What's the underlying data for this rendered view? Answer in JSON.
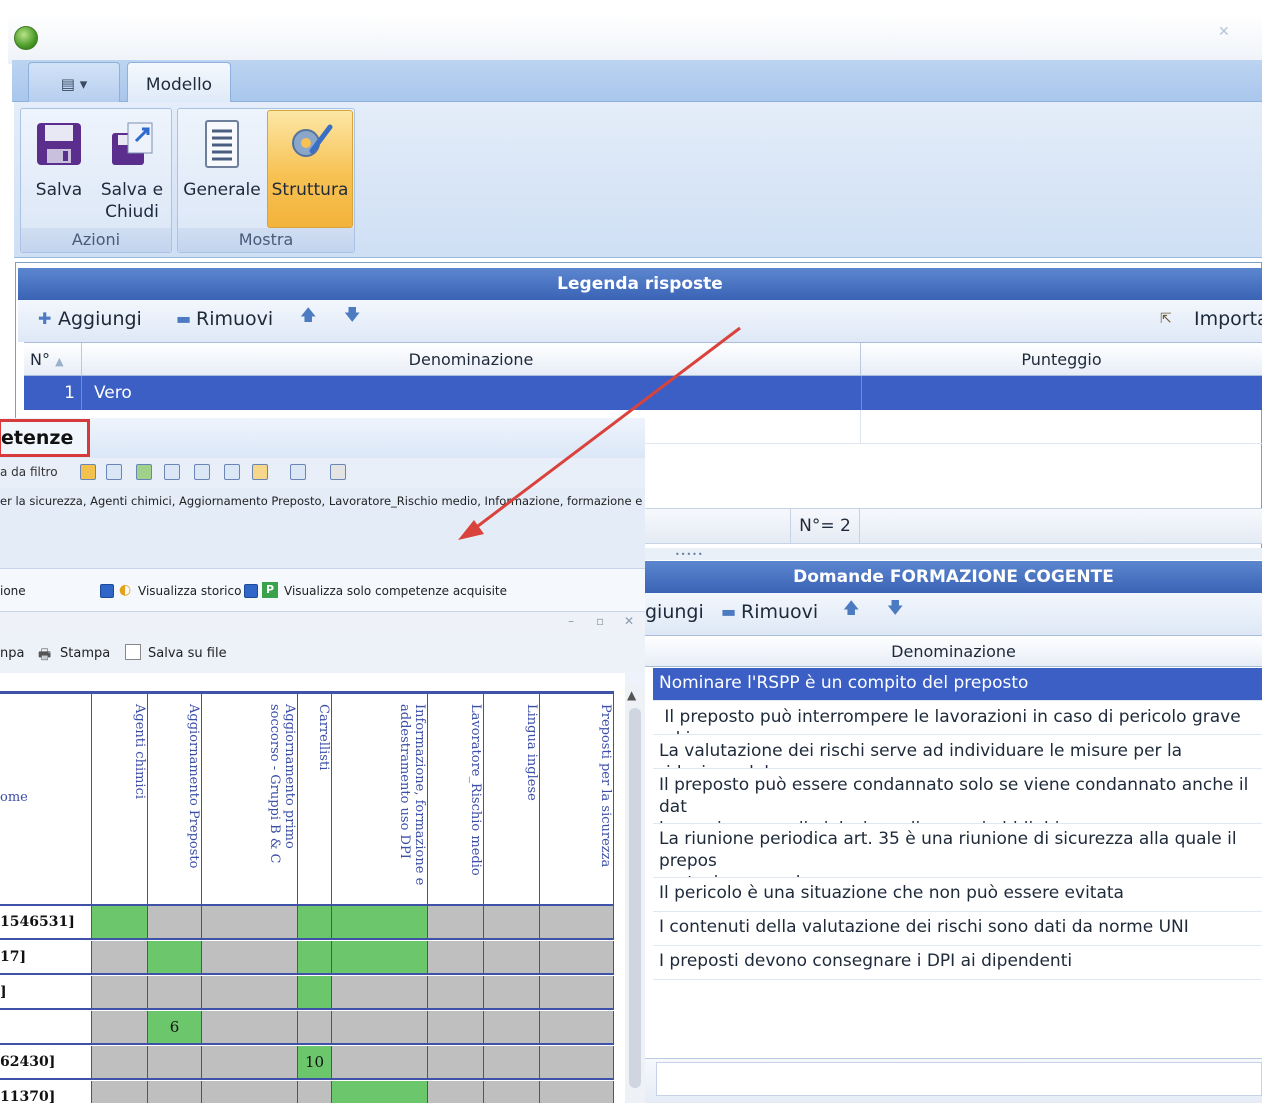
{
  "ribbon": {
    "tab_modello": "Modello",
    "buttons": {
      "salva": "Salva",
      "salva_chiudi_1": "Salva e",
      "salva_chiudi_2": "Chiudi",
      "generale": "Generale",
      "struttura": "Struttura"
    },
    "groups": {
      "azioni": "Azioni",
      "mostra": "Mostra"
    }
  },
  "legenda": {
    "title": "Legenda risposte",
    "toolbar": {
      "aggiungi": "Aggiungi",
      "rimuovi": "Rimuovi",
      "importa": "Importa"
    },
    "columns": {
      "num": "N°",
      "denominazione": "Denominazione",
      "punteggio": "Punteggio"
    },
    "rows": [
      {
        "num": "1",
        "denominazione": "Vero"
      }
    ],
    "count": "N°= 2"
  },
  "domande": {
    "title": "Domande  FORMAZIONE COGENTE",
    "toolbar": {
      "aggiungi": "giungi",
      "rimuovi": "Rimuovi"
    },
    "column": "Denominazione",
    "rows": [
      "Nominare l'RSPP è un compito del preposto",
      " Il preposto può interrompere le lavorazioni in caso di pericolo grave ed im",
      "La valutazione dei rischi serve ad individuare le misure per la riduzione del",
      "Il preposto può essere condannato solo se viene condannato anche il dat\nlavoro in casoo di violazione die propri obblighi",
      "La riunione periodica art. 35 è una riunione di sicurezza alla quale il prepos\npartecipare per legge",
      "Il pericolo è una situazione che non può essere evitata",
      "I contenuti della valutazione dei rischi sono dati da norme UNI",
      "I preposti devono consegnare i DPI ai dipendenti"
    ]
  },
  "competenze": {
    "title": "etenze",
    "toolbar_filter": "a da filtro",
    "filter_text": "er la sicurezza, Agenti chimici, Aggiornamento Preposto, Lavoratore_Rischio medio, Informazione, formazione e addestr",
    "option_left": "ione",
    "option_storico": "Visualizza storico",
    "option_acquisite": "Visualizza solo competenze acquisite",
    "print_left": "npa",
    "print_stampa": "Stampa",
    "print_salva": "Salva su file",
    "row_header_label": "ome",
    "columns": [
      "Agenti chimici",
      "Aggiornamento Preposto",
      "Aggiornamento primo soccorso - Gruppi B & C",
      "Carrellisti",
      "Informazione, formazione e addestramento uso DPI",
      "Lavoratore_Rischio medio",
      "Lingua inglese",
      "Preposti per la sicurezza"
    ],
    "rows": [
      {
        "label": "1546531]",
        "cells": [
          "g",
          "",
          "",
          "g",
          "g",
          "",
          "",
          ""
        ]
      },
      {
        "label": "17]",
        "cells": [
          "",
          "g",
          "",
          "g",
          "g",
          "",
          "",
          ""
        ]
      },
      {
        "label": "]",
        "cells": [
          "",
          "",
          "",
          "g",
          "",
          "",
          "",
          ""
        ]
      },
      {
        "label": "",
        "cells": [
          "",
          "6",
          "",
          "",
          "",
          "",
          "",
          ""
        ]
      },
      {
        "label": "62430]",
        "cells": [
          "",
          "",
          "",
          "10",
          "",
          "",
          "",
          ""
        ]
      },
      {
        "label": "11370]",
        "cells": [
          "",
          "",
          "",
          "",
          "g",
          "",
          "",
          ""
        ]
      }
    ]
  },
  "colors": {
    "header_blue": "#3a63b5",
    "selection_blue": "#3b5fc4",
    "acquired_green": "#6cc66c",
    "highlight_red": "#d63a3a",
    "struttura_orange": "#f7c253"
  }
}
